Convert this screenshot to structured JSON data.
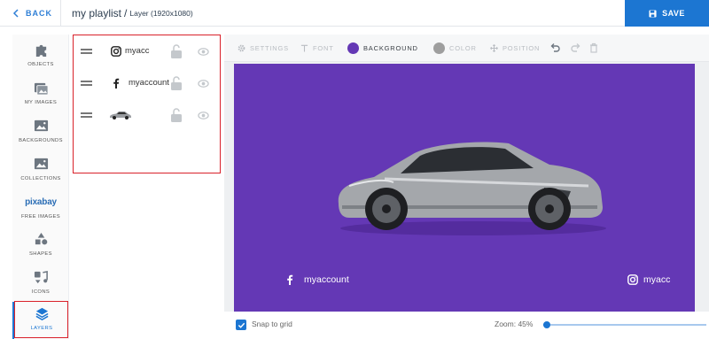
{
  "header": {
    "back_label": "BACK",
    "title": "my playlist",
    "title_separator": "/",
    "subtitle": "Layer (1920x1080)",
    "save_label": "SAVE"
  },
  "sidebar": {
    "items": [
      {
        "icon": "puzzle-icon",
        "label": "OBJECTS"
      },
      {
        "icon": "images-icon",
        "label": "MY IMAGES"
      },
      {
        "icon": "image-icon",
        "label": "BACKGROUNDS"
      },
      {
        "icon": "image-icon",
        "label": "COLLECTIONS"
      },
      {
        "icon": "pixabay-logo",
        "logo_text": "pixabay",
        "label": "FREE IMAGES"
      },
      {
        "icon": "shapes-icon",
        "label": "SHAPES"
      },
      {
        "icon": "music-icon",
        "label": "ICONS"
      },
      {
        "icon": "layers-icon",
        "label": "LAYERS",
        "active": true
      }
    ]
  },
  "layers": [
    {
      "icon": "instagram-icon",
      "name": "myacc",
      "locked": false,
      "visible": true
    },
    {
      "icon": "facebook-icon",
      "name": "myaccount",
      "locked": false,
      "visible": true
    },
    {
      "icon": "car-thumbnail",
      "name": "",
      "locked": false,
      "visible": true
    }
  ],
  "toolbar": {
    "settings_label": "SETTINGS",
    "font_label": "FONT",
    "background_label": "BACKGROUND",
    "color_label": "COLOR",
    "position_label": "POSITION",
    "background_color": "#6438b5",
    "text_color_swatch": "#9e9e9e"
  },
  "canvas": {
    "background_color": "#6438b5",
    "facebook_text": "myaccount",
    "instagram_text": "myacc"
  },
  "bottom": {
    "snap_label": "Snap to grid",
    "snap_checked": true,
    "zoom_label": "Zoom: 45%",
    "zoom_fraction": 0.02
  },
  "colors": {
    "accent": "#1c76d2",
    "highlight_border": "#d9212a"
  }
}
